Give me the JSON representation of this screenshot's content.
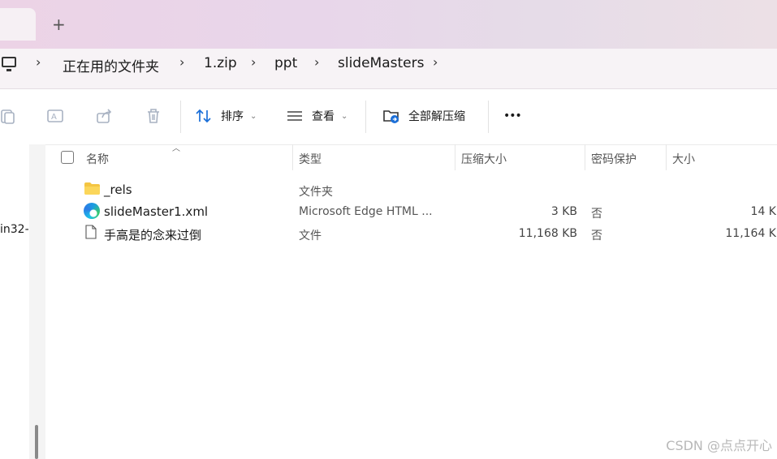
{
  "titlebar": {
    "close_glyph": "✕",
    "add_glyph": "+"
  },
  "breadcrumb": {
    "items": [
      "正在用的文件夹",
      "1.zip",
      "ppt",
      "slideMasters"
    ],
    "separator": "›"
  },
  "toolbar": {
    "sort_label": "排序",
    "view_label": "查看",
    "extract_label": "全部解压缩",
    "more_label": "•••"
  },
  "left_pane": {
    "partial_text": "in32-"
  },
  "columns": {
    "name": "名称",
    "type": "类型",
    "compressed_size": "压缩大小",
    "password": "密码保护",
    "size": "大小"
  },
  "files": [
    {
      "name": "_rels",
      "type": "文件夹",
      "compressed_size": "",
      "password": "",
      "size": "",
      "icon": "folder-icon"
    },
    {
      "name": "slideMaster1.xml",
      "type": "Microsoft Edge HTML ...",
      "compressed_size": "3 KB",
      "password": "否",
      "size": "14 K",
      "icon": "edge-icon"
    },
    {
      "name": "手高是的念来过倒",
      "type": "文件",
      "compressed_size": "11,168 KB",
      "password": "否",
      "size": "11,164 K",
      "icon": "file-icon"
    }
  ],
  "watermark": "CSDN @点点开心",
  "colors": {
    "folder": "#f4c542",
    "accent": "#1b6fd8"
  }
}
